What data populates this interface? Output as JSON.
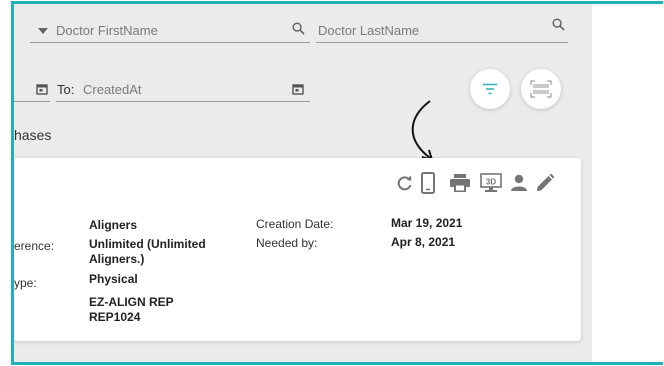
{
  "filters": {
    "doctor_firstname_placeholder": "Doctor FirstName",
    "doctor_lastname_placeholder": "Doctor LastName",
    "to_label": "To:",
    "to_placeholder": "CreatedAt"
  },
  "section": {
    "title": "hases"
  },
  "case": {
    "reference_label": "erence:",
    "type_label": "ype:",
    "product": "Aligners",
    "reference_value": "Unlimited (Unlimited Aligners.)",
    "type_value": "Physical",
    "rep_line1": "EZ-ALIGN REP",
    "rep_line2": "REP1024",
    "creation_date_label": "Creation Date:",
    "needed_by_label": "Needed by:",
    "creation_date": "Mar 19, 2021",
    "needed_by": "Apr 8, 2021"
  },
  "toolbar_icons": [
    "refresh-icon",
    "phone-icon",
    "print-icon",
    "3d-view-icon",
    "person-icon",
    "edit-icon"
  ],
  "colors": {
    "frame": "#1fb1b7",
    "background": "#ebebeb",
    "icon": "#757575"
  }
}
